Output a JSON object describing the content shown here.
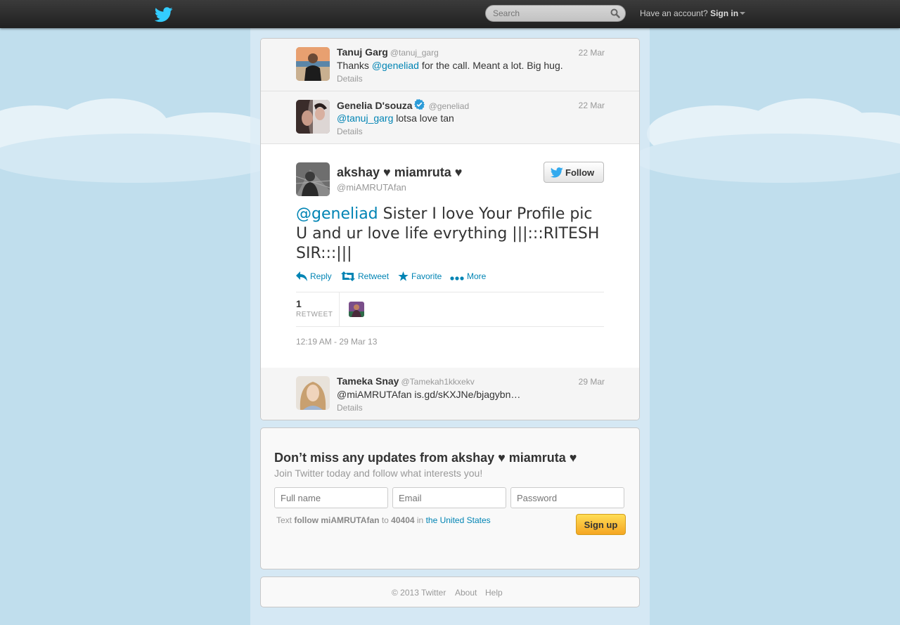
{
  "topbar": {
    "search_placeholder": "Search",
    "have_account": "Have an account?",
    "sign_in": "Sign in"
  },
  "tweets": [
    {
      "name": "Tanuj Garg",
      "handle": "@tanuj_garg",
      "date": "22 Mar",
      "text_pre": "Thanks ",
      "mention": "@geneliad",
      "text_post": " for the call. Meant a lot. Big hug.",
      "details": "Details"
    },
    {
      "name": "Genelia D'souza",
      "handle": "@geneliad",
      "date": "22 Mar",
      "mention": "@tanuj_garg",
      "text_post": " lotsa love tan",
      "details": "Details"
    }
  ],
  "main_tweet": {
    "name": "akshay ♥ miamruta ♥",
    "handle": "@miAMRUTAfan",
    "follow_label": "Follow",
    "mention": "@geneliad",
    "text": " Sister I love Your Profile pic U and ur love life evrything |||:::RITESH SIR:::|||",
    "actions": {
      "reply": "Reply",
      "retweet": "Retweet",
      "favorite": "Favorite",
      "more": "More"
    },
    "retweet_count": "1",
    "retweet_label": "RETWEET",
    "timestamp": "12:19 AM - 29 Mar 13"
  },
  "reply_tweet": {
    "name": "Tameka Snay",
    "handle": "@Tamekah1kkxekv",
    "date": "29 Mar",
    "text": "@miAMRUTAfan is.gd/sKXJNe/bjagybn…",
    "details": "Details"
  },
  "signup": {
    "title": "Don’t miss any updates from akshay ♥ miamruta ♥",
    "subtitle": "Join Twitter today and follow what interests you!",
    "full_name_placeholder": "Full name",
    "email_placeholder": "Email",
    "password_placeholder": "Password",
    "sms_text": "Text",
    "sms_command": "follow miAMRUTAfan",
    "sms_to": "to",
    "sms_number": "40404",
    "sms_in": "in",
    "sms_country": "the United States",
    "button": "Sign up"
  },
  "footer": {
    "copyright": "© 2013 Twitter",
    "about": "About",
    "help": "Help"
  },
  "colors": {
    "link": "#0084b4",
    "background": "#c0deed",
    "signup_button": "#f5a623"
  }
}
